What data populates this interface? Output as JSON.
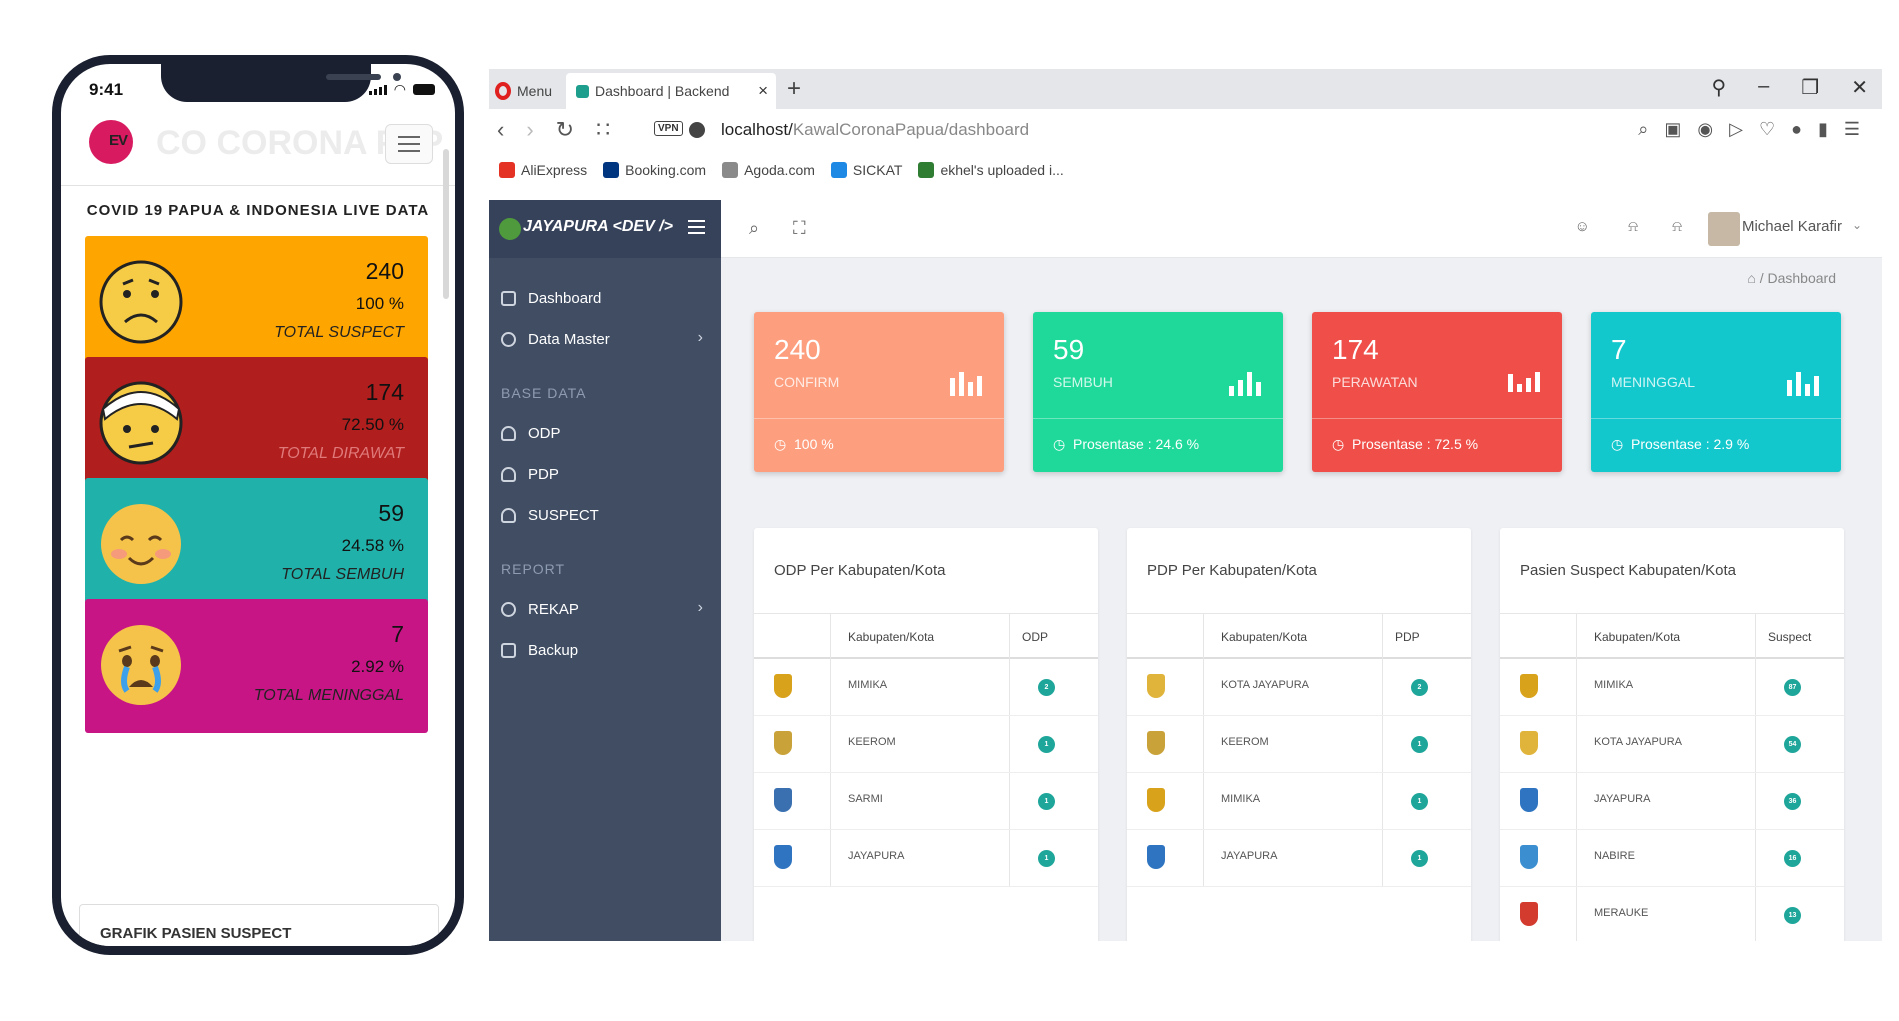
{
  "phone": {
    "time": "9:41",
    "logo_text": "EV",
    "ghost_text": "CO CORONA PAP",
    "title": "COVID 19 PAPUA & INDONESIA LIVE DATA",
    "cards": [
      {
        "number": "240",
        "percent": "100 %",
        "label": "TOTAL SUSPECT",
        "color": "#ffa500",
        "label_color": "#222222",
        "emoji": "sad-face"
      },
      {
        "number": "174",
        "percent": "72.50 %",
        "label": "TOTAL DIRAWAT",
        "color": "#b01e1e",
        "label_color": "#e07a7a",
        "emoji": "bandaged-face"
      },
      {
        "number": "59",
        "percent": "24.58 %",
        "label": "TOTAL SEMBUH",
        "color": "#20b2aa",
        "label_color": "#222222",
        "emoji": "smiling-face"
      },
      {
        "number": "7",
        "percent": "2.92 %",
        "label": "TOTAL MENINGGAL",
        "color": "#c71585",
        "label_color": "#222222",
        "emoji": "crying-face"
      }
    ],
    "grafik_label": "GRAFIK PASIEN SUSPECT"
  },
  "browser": {
    "menu_label": "Menu",
    "tab_title": "Dashboard | Backend",
    "tab_close": "×",
    "new_tab": "+",
    "url_host": "localhost/",
    "url_path": "KawalCoronaPapua/dashboard",
    "bookmarks": [
      {
        "label": "AliExpress",
        "color": "#e43225"
      },
      {
        "label": "Booking.com",
        "color": "#003580"
      },
      {
        "label": "Agoda.com",
        "color": "#8a8a8a"
      },
      {
        "label": "SICKAT",
        "color": "#1e88e5"
      },
      {
        "label": "ekhel's uploaded i...",
        "color": "#2e7d32"
      }
    ]
  },
  "app": {
    "brand": "JAYAPURA <DEV />",
    "nav": {
      "dashboard": "Dashboard",
      "data_master": "Data Master",
      "base_data_heading": "BASE DATA",
      "odp": "ODP",
      "pdp": "PDP",
      "suspect": "SUSPECT",
      "report_heading": "REPORT",
      "rekap": "REKAP",
      "backup": "Backup"
    },
    "user_name": "Michael Karafir",
    "breadcrumb": "Dashboard",
    "stats": [
      {
        "number": "240",
        "label": "CONFIRM",
        "footer": "100 %",
        "color": "#fd9f7f"
      },
      {
        "number": "59",
        "label": "SEMBUH",
        "footer": "Prosentase : 24.6 %",
        "color": "#1ed99a"
      },
      {
        "number": "174",
        "label": "PERAWATAN",
        "footer": "Prosentase : 72.5 %",
        "color": "#ef4f48"
      },
      {
        "number": "7",
        "label": "MENINGGAL",
        "footer": "Prosentase : 2.9 %",
        "color": "#13c8cc"
      }
    ],
    "panels": [
      {
        "title": "ODP Per Kabupaten/Kota",
        "col_region": "Kabupaten/Kota",
        "col_value": "ODP",
        "rows": [
          {
            "name": "MIMIKA",
            "value": "2",
            "crest": "#d9a21b"
          },
          {
            "name": "KEEROM",
            "value": "1",
            "crest": "#c9a33a"
          },
          {
            "name": "SARMI",
            "value": "1",
            "crest": "#3a6fb0"
          },
          {
            "name": "JAYAPURA",
            "value": "1",
            "crest": "#2f74c0"
          }
        ]
      },
      {
        "title": "PDP Per Kabupaten/Kota",
        "col_region": "Kabupaten/Kota",
        "col_value": "PDP",
        "rows": [
          {
            "name": "KOTA JAYAPURA",
            "value": "2",
            "crest": "#e0b43a"
          },
          {
            "name": "KEEROM",
            "value": "1",
            "crest": "#c9a33a"
          },
          {
            "name": "MIMIKA",
            "value": "1",
            "crest": "#d9a21b"
          },
          {
            "name": "JAYAPURA",
            "value": "1",
            "crest": "#2f74c0"
          }
        ]
      },
      {
        "title": "Pasien Suspect Kabupaten/Kota",
        "col_region": "Kabupaten/Kota",
        "col_value": "Suspect",
        "rows": [
          {
            "name": "MIMIKA",
            "value": "87",
            "crest": "#d9a21b"
          },
          {
            "name": "KOTA JAYAPURA",
            "value": "54",
            "crest": "#e0b43a"
          },
          {
            "name": "JAYAPURA",
            "value": "36",
            "crest": "#2f74c0"
          },
          {
            "name": "NABIRE",
            "value": "16",
            "crest": "#3b8fd0"
          },
          {
            "name": "MERAUKE",
            "value": "13",
            "crest": "#d23b2e"
          }
        ]
      }
    ]
  }
}
